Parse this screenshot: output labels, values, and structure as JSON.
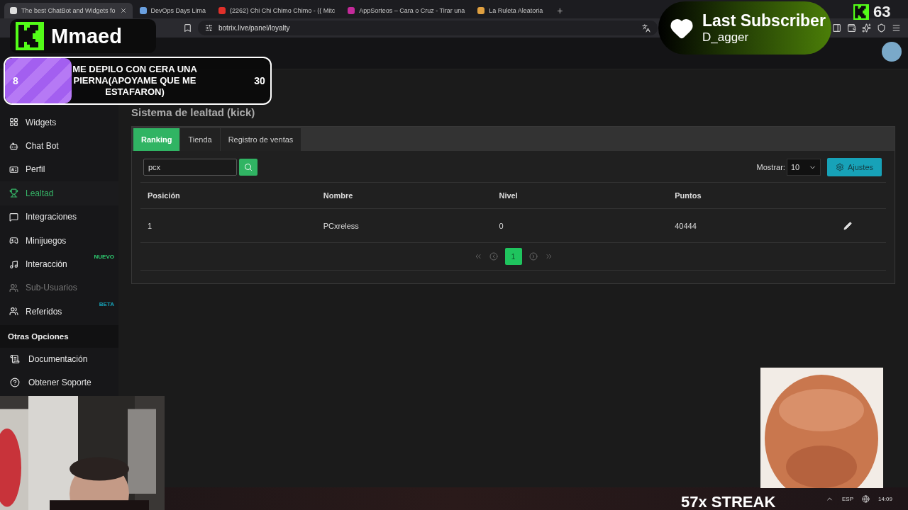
{
  "browser": {
    "tabs": [
      {
        "title": "The best ChatBot and Widgets fo",
        "selected": true
      },
      {
        "title": "DevOps Days Lima",
        "selected": false
      },
      {
        "title": "(2262) Chi Chi Chimo Chimo - (( Mitc",
        "selected": false
      },
      {
        "title": "AppSorteos – Cara o Cruz - Tirar una",
        "selected": false
      },
      {
        "title": "La Ruleta Aleatoria",
        "selected": false
      }
    ],
    "new_tab": "+",
    "url": "botrix.live/panel/loyalty"
  },
  "sidebar": {
    "items": [
      {
        "label": "Widgets",
        "selected": false,
        "disabled": false
      },
      {
        "label": "Chat Bot",
        "selected": false,
        "disabled": false
      },
      {
        "label": "Perfil",
        "selected": false,
        "disabled": false
      },
      {
        "label": "Lealtad",
        "selected": true,
        "disabled": false
      },
      {
        "label": "Integraciones",
        "selected": false,
        "disabled": false
      },
      {
        "label": "Minijuegos",
        "selected": false,
        "disabled": false
      },
      {
        "label": "Interacción",
        "selected": false,
        "disabled": false,
        "badge": "NUEVO",
        "color": "#2ecc71"
      },
      {
        "label": "Sub-Usuarios",
        "selected": false,
        "disabled": true
      },
      {
        "label": "Referidos",
        "selected": false,
        "disabled": false,
        "badge": "BETA",
        "color": "#17a2b8"
      }
    ],
    "section_title": "Otras Opciones",
    "other_items": [
      {
        "label": "Documentación"
      },
      {
        "label": "Obtener Soporte"
      }
    ]
  },
  "page": {
    "title": "Sistema de lealtad (kick)"
  },
  "tabs": [
    {
      "label": "Ranking",
      "selected": true
    },
    {
      "label": "Tienda",
      "selected": false
    },
    {
      "label": "Registro de ventas",
      "selected": false
    }
  ],
  "search": {
    "value": "pcx"
  },
  "show": {
    "label": "Mostrar:",
    "value": "10"
  },
  "settings_button": "Ajustes",
  "table": {
    "columns": [
      "Posición",
      "Nombre",
      "Nivel",
      "Puntos"
    ],
    "rows": [
      {
        "cells": [
          "1",
          "PCxreless",
          "0",
          "40444"
        ]
      }
    ]
  },
  "pagination": {
    "pages": [
      {
        "label": "1",
        "selected": true
      }
    ]
  },
  "overlays": {
    "streamer": "Mmaed",
    "goal": {
      "title": "ME DEPILO CON CERA UNA PIERNA(APOYAME QUE ME ESTAFARON)",
      "current": "8",
      "target": "30",
      "level": 0.25
    },
    "subscriber": {
      "title": "Last Subscriber",
      "name": "D_agger"
    },
    "viewers": "63",
    "streak": "57x STREAK"
  },
  "taskbar": {
    "language": "ESP",
    "time": "14:09"
  }
}
